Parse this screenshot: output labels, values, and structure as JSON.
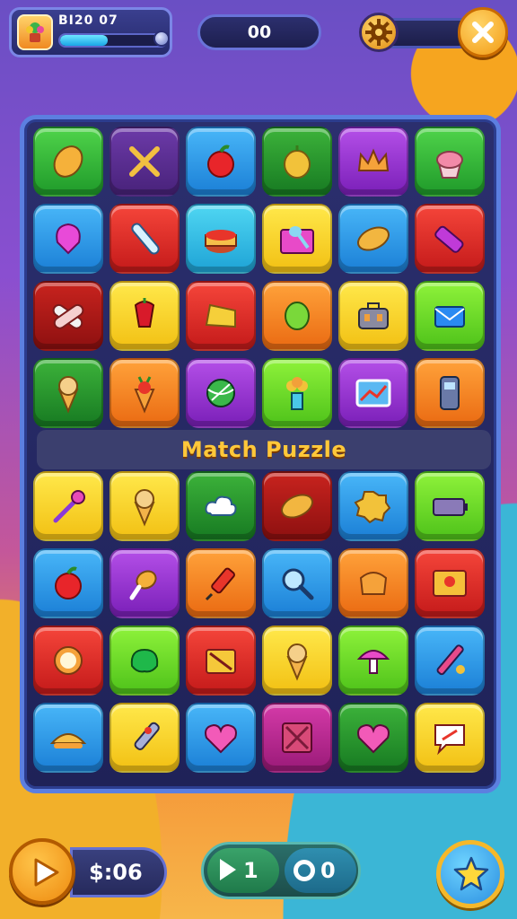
{
  "header": {
    "player_score": "BI20 07",
    "xp_progress": 0.45,
    "center_counter": "00",
    "settings_icon": "gear-icon",
    "close_icon": "close-icon"
  },
  "board": {
    "title": "Match Puzzle",
    "rows_top": [
      [
        {
          "icon": "leaf",
          "color": "green"
        },
        {
          "icon": "crossed-sticks",
          "color": "dkpurple"
        },
        {
          "icon": "apple",
          "color": "blue"
        },
        {
          "icon": "onion",
          "color": "dkgreen"
        },
        {
          "icon": "crown",
          "color": "purple"
        },
        {
          "icon": "cupcake",
          "color": "green"
        }
      ],
      [
        {
          "icon": "balloon",
          "color": "blue"
        },
        {
          "icon": "test-tube",
          "color": "red"
        },
        {
          "icon": "cake",
          "color": "cyan"
        },
        {
          "icon": "spoon",
          "color": "yellow"
        },
        {
          "icon": "bread",
          "color": "blue"
        },
        {
          "icon": "marker",
          "color": "red"
        }
      ],
      [
        {
          "icon": "bandage",
          "color": "dkred"
        },
        {
          "icon": "flower",
          "color": "yellow"
        },
        {
          "icon": "cheese",
          "color": "red"
        },
        {
          "icon": "olive",
          "color": "orange"
        },
        {
          "icon": "toolbox",
          "color": "yellow"
        },
        {
          "icon": "envelope",
          "color": "lime"
        }
      ],
      [
        {
          "icon": "ice-cream",
          "color": "dkgreen"
        },
        {
          "icon": "carrot",
          "color": "orange"
        },
        {
          "icon": "ball",
          "color": "purple"
        },
        {
          "icon": "flower-vase",
          "color": "lime"
        },
        {
          "icon": "picture",
          "color": "purple"
        },
        {
          "icon": "phone",
          "color": "orange"
        }
      ]
    ],
    "rows_bottom": [
      [
        {
          "icon": "wand",
          "color": "yellow"
        },
        {
          "icon": "ice-cream",
          "color": "yellow"
        },
        {
          "icon": "cloud",
          "color": "dkgreen"
        },
        {
          "icon": "bread",
          "color": "dkred"
        },
        {
          "icon": "cookie",
          "color": "blue"
        },
        {
          "icon": "battery",
          "color": "lime"
        }
      ],
      [
        {
          "icon": "apple",
          "color": "blue"
        },
        {
          "icon": "drumstick",
          "color": "purple"
        },
        {
          "icon": "syringe",
          "color": "orange"
        },
        {
          "icon": "magnifier",
          "color": "blue"
        },
        {
          "icon": "bag",
          "color": "orange"
        },
        {
          "icon": "key-card",
          "color": "red"
        }
      ],
      [
        {
          "icon": "egg",
          "color": "red"
        },
        {
          "icon": "slime",
          "color": "lime"
        },
        {
          "icon": "pencil-box",
          "color": "red"
        },
        {
          "icon": "ice-cream",
          "color": "yellow"
        },
        {
          "icon": "mushroom",
          "color": "lime"
        },
        {
          "icon": "screwdriver",
          "color": "blue"
        }
      ],
      [
        {
          "icon": "taco",
          "color": "blue"
        },
        {
          "icon": "pen",
          "color": "yellow"
        },
        {
          "icon": "heart",
          "color": "blue"
        },
        {
          "icon": "x-box",
          "color": "magenta"
        },
        {
          "icon": "heart",
          "color": "dkgreen"
        },
        {
          "icon": "chat",
          "color": "yellow"
        }
      ]
    ]
  },
  "footer": {
    "coins": "$:06",
    "moves": "1",
    "tokens": "0",
    "play_icon": "play-icon",
    "star_icon": "star-icon"
  }
}
